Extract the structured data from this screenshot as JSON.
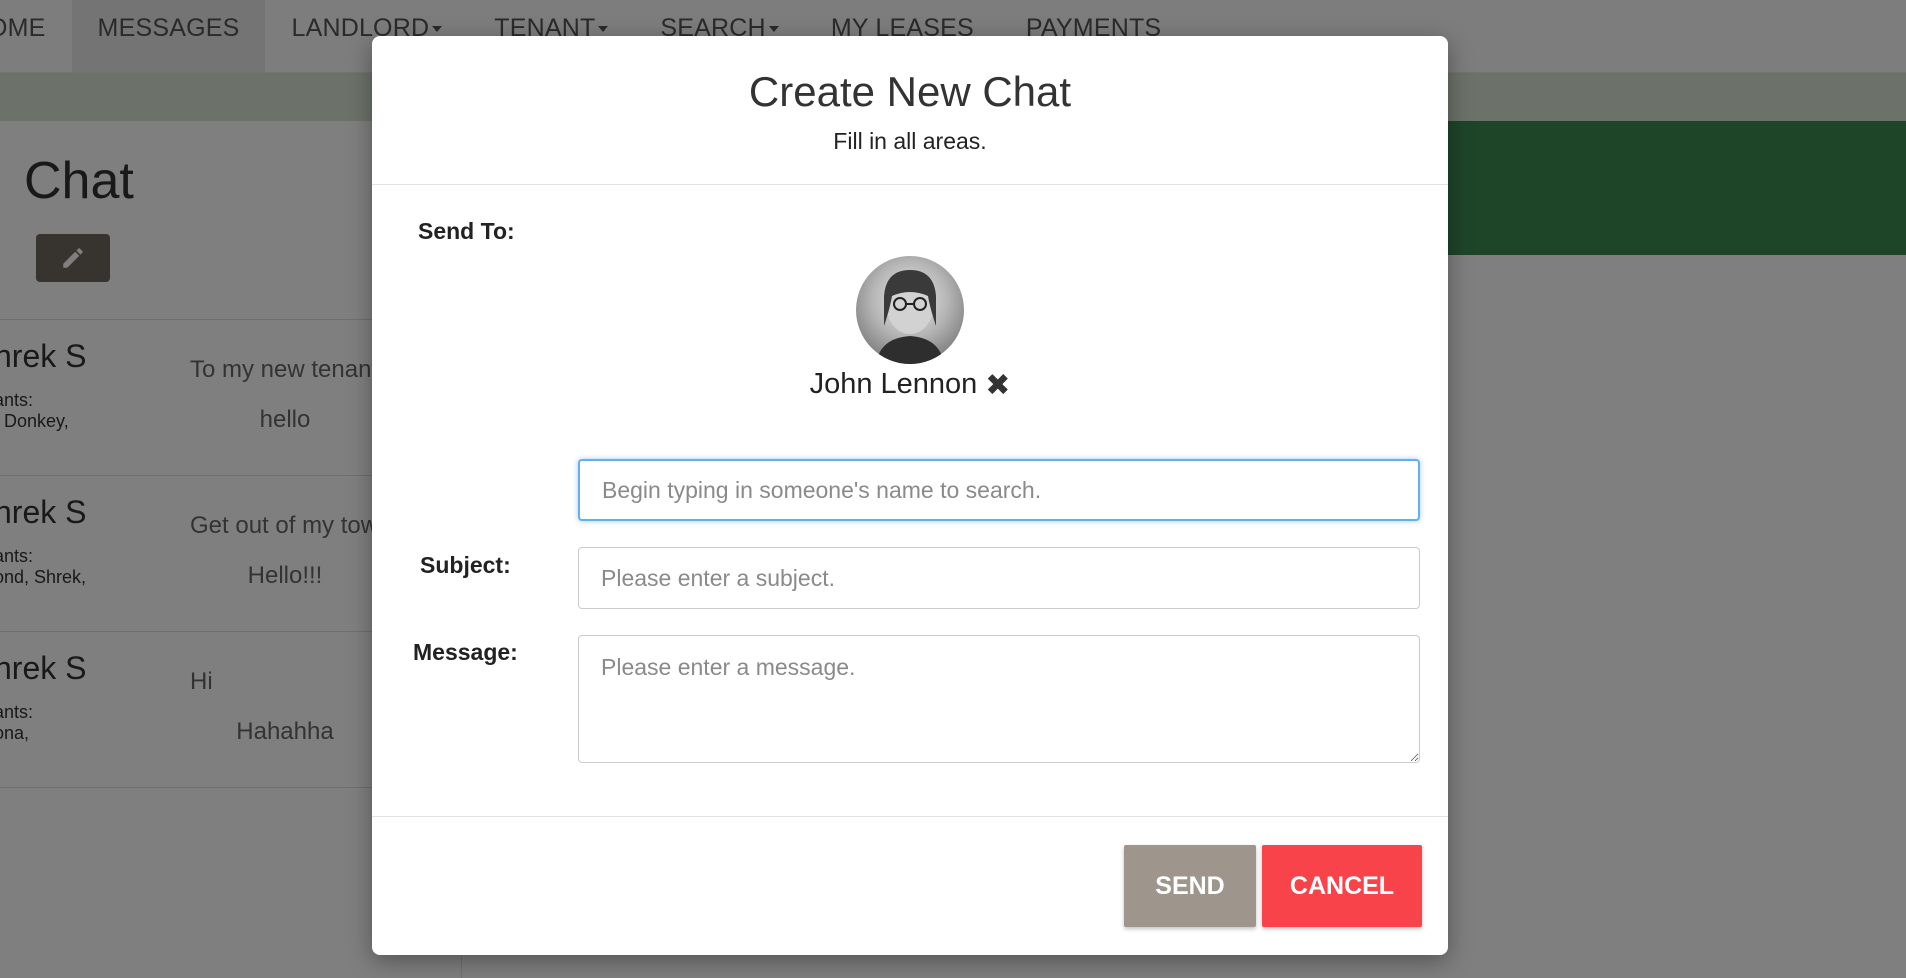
{
  "nav": {
    "items": [
      {
        "label": "OME",
        "caret": false
      },
      {
        "label": "MESSAGES",
        "caret": false,
        "active": true
      },
      {
        "label": "LANDLORD",
        "caret": true
      },
      {
        "label": "TENANT",
        "caret": true
      },
      {
        "label": "SEARCH",
        "caret": true
      },
      {
        "label": "MY LEASES",
        "caret": false
      },
      {
        "label": "PAYMENTS",
        "caret": false
      }
    ]
  },
  "chat_panel": {
    "title": "Chat",
    "edit_icon": "pencil-icon",
    "rows": [
      {
        "name": "hrek S",
        "label": "ants:",
        "tenants": ", Donkey,",
        "subject": "To my new tenants",
        "preview": "hello"
      },
      {
        "name": "hrek S",
        "label": "ants:",
        "tenants": "ond, Shrek,",
        "subject": "Get out of my town",
        "preview": "Hello!!!"
      },
      {
        "name": "hrek S",
        "label": "ants:",
        "tenants": "ona,",
        "subject": "Hi",
        "preview": "Hahahha"
      }
    ]
  },
  "modal": {
    "title": "Create New Chat",
    "subtitle": "Fill in all areas.",
    "send_to_label": "Send To:",
    "recipient": {
      "name": "John Lennon",
      "remove_icon": "close-x-icon",
      "remove_glyph": "✖"
    },
    "search": {
      "value": "",
      "placeholder": "Begin typing in someone's name to search."
    },
    "subject_label": "Subject:",
    "subject": {
      "value": "",
      "placeholder": "Please enter a subject."
    },
    "message_label": "Message:",
    "message": {
      "value": "",
      "placeholder": "Please enter a message."
    },
    "send_label": "SEND",
    "cancel_label": "CANCEL"
  },
  "colors": {
    "send_button": "#9e958c",
    "cancel_button": "#f9434a",
    "focus_border": "#66afe9",
    "banner": "#3e8a52",
    "edit_button": "#6f665c"
  }
}
